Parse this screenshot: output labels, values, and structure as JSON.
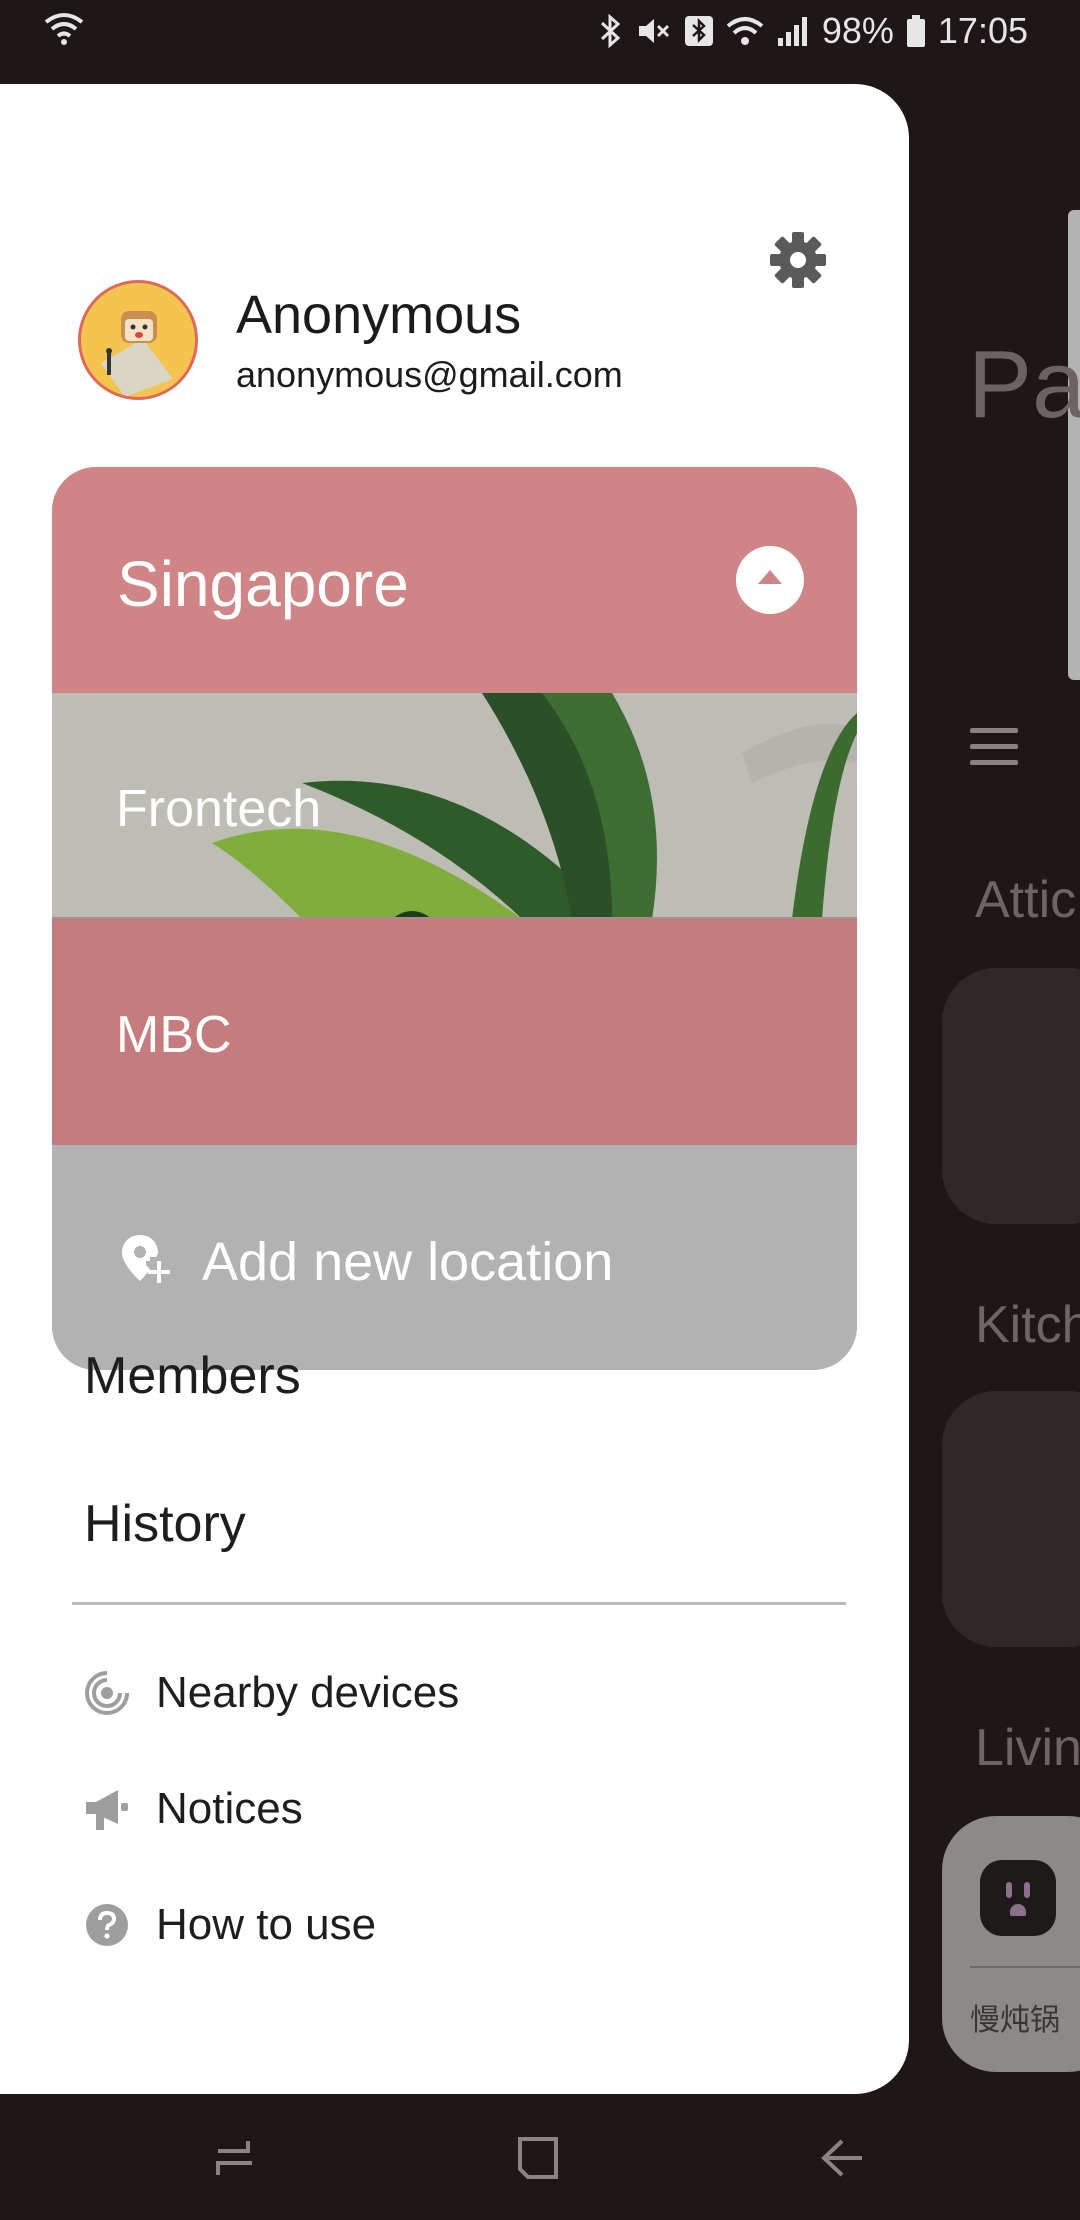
{
  "status_bar": {
    "battery": "98%",
    "time": "17:05"
  },
  "drawer": {
    "user": {
      "name": "Anonymous",
      "email": "anonymous@gmail.com"
    },
    "location_selector": {
      "current": "Singapore",
      "locations": [
        "Frontech",
        "MBC"
      ],
      "add_label": "Add new location"
    },
    "menu": {
      "members": "Members",
      "history": "History"
    },
    "secondary_menu": [
      {
        "label": "Nearby devices",
        "icon": "nearby-icon"
      },
      {
        "label": "Notices",
        "icon": "megaphone-icon"
      },
      {
        "label": "How to use",
        "icon": "help-icon"
      }
    ]
  },
  "background_app": {
    "title_partial": "Pa",
    "rooms": [
      "Attic",
      "Kitch",
      "Livin"
    ],
    "device_label": "慢炖锅"
  },
  "colors": {
    "accent": "#cf8586",
    "accent_dark": "#c47c7e",
    "panel_gray": "#b2b2b2"
  }
}
